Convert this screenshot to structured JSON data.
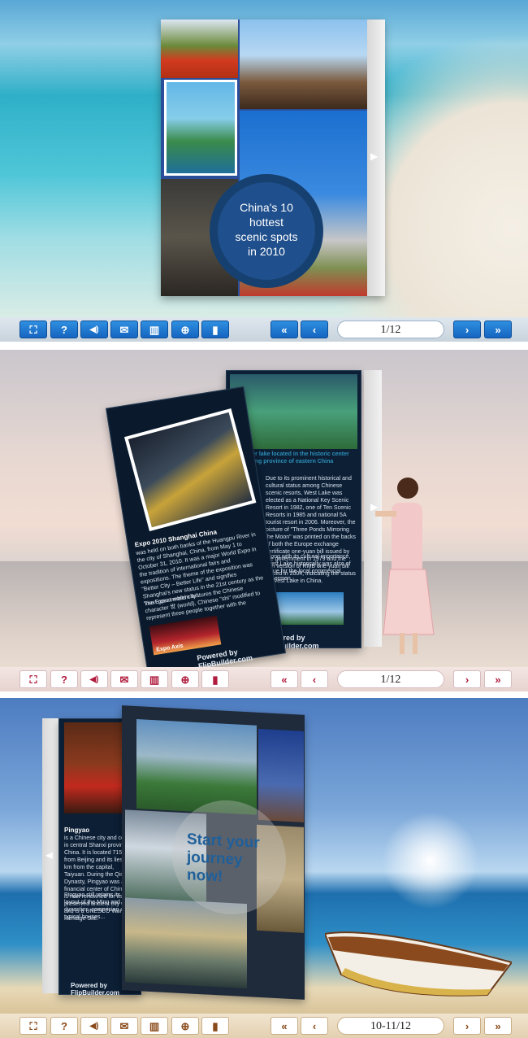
{
  "toolbar_icons": [
    "fullscreen-icon",
    "help-icon",
    "sound-icon",
    "email-icon",
    "thumbnails-icon",
    "zoom-icon",
    "page-icon"
  ],
  "toolbar_glyphs": [
    "⛶",
    "?",
    "◀)",
    "✉",
    "▥",
    "⊕",
    "▮"
  ],
  "nav": {
    "first": "«",
    "prev": "‹",
    "next": "›",
    "last": "»"
  },
  "screens": [
    {
      "page_indicator": "1/12",
      "cover": {
        "title_line1": "China's 10",
        "title_line2": "hottest",
        "title_line3": "scenic spots",
        "title_line4": "in 2010"
      }
    },
    {
      "page_indicator": "1/12",
      "left_page": {
        "heading": "Expo 2010 Shanghai China",
        "body": "was held on both banks of the Huangpu River in the city of Shanghai, China, from May 1 to October 31, 2010. It was a major World Expo in the tradition of international fairs and expositions. The theme of the exposition was \"Better City – Better Life\" and signifies Shanghai's new status in the 21st century as the \"next great world city\".",
        "body2": "The Expo emblem features the Chinese character 世 (world), Chinese \"shi\" modified to represent three people together with the",
        "caption": "Expo Axis",
        "powered": "Powered by FlipBuilder.com"
      },
      "right_page": {
        "heading": "Best-ever lake located in the historic center of Zhejiang province of eastern China",
        "body": "Due to its prominent historical and cultural status among Chinese scenic resorts, West Lake was elected as a National Key Scenic Resort in 1982, one of Ten Scenic Resorts in 1985 and national 5A tourist resort in 2006. Moreover, the picture of \"Three Ponds Mirroring the Moon\" was printed on the backs of both the Europe exchange certificate one-yuan bill issued by the government in 1979 and the fifth version of RMB one-yuan bill issued in 2004, indicating the status of West Lake in China.",
        "body2": "Along with its cultural importance, West Lake historically was also of value for the local commercial fishermen.",
        "powered": "Powered by FlipBuilder.com"
      }
    },
    {
      "page_indicator": "10-11/12",
      "left_page": {
        "heading": "Pingyao",
        "body": "is a Chinese city and county in central Shanxi province, China. It is located 715 km from Beijing and its lies 80 km from the capital, Taiyuan. During the Qing Dynasty, Pingyao was a financial center of China. It is now renowned for its well-preserved ancient city wall, and is a UNESCO World Heritage Site.",
        "body2": "Pingyao still retains its city layout of the Ming and Qing dynasties, comprising of typical houses...",
        "powered": "Powered by FlipBuilder.com"
      },
      "turning_page": {
        "text": "Start your journey now!"
      }
    }
  ]
}
